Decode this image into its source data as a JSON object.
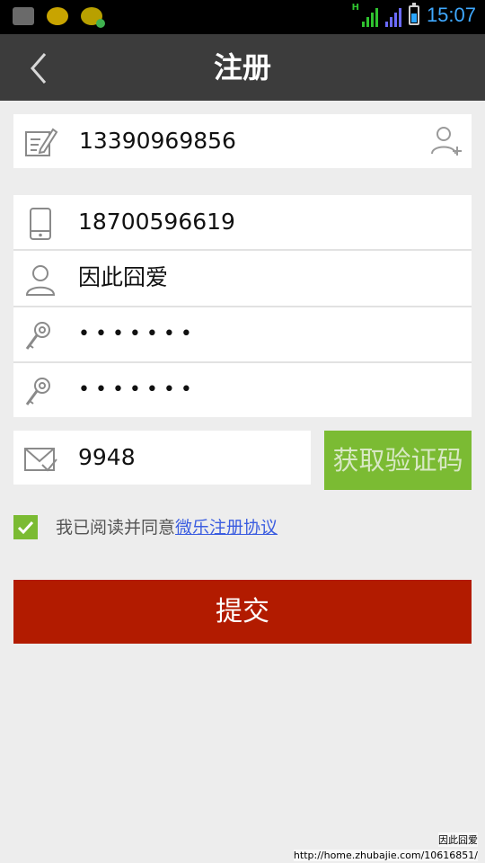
{
  "status_bar": {
    "time": "15:07",
    "signal_letter": "H",
    "notification_icons": [
      "sim-icon",
      "app-icon",
      "app-sync-icon"
    ]
  },
  "header": {
    "title": "注册",
    "back_icon": "chevron-left-icon"
  },
  "form": {
    "referrer_phone": "13390969856",
    "mobile": "18700596619",
    "username": "因此囧爱",
    "password": "•••••••",
    "confirm_password": "•••••••",
    "verify_code": "9948",
    "get_code_label": "获取验证码"
  },
  "agreement": {
    "checked": true,
    "text": "我已阅读并同意",
    "link": "微乐注册协议"
  },
  "submit_label": "提交",
  "watermark": {
    "name": "因此囧爱",
    "url": "http://home.zhubajie.com/10616851/"
  },
  "colors": {
    "header_bg": "#3c3c3c",
    "accent_green": "#7bbb33",
    "submit_red": "#b21b00",
    "link_blue": "#3b5de0",
    "clock_blue": "#3fa9ff"
  }
}
